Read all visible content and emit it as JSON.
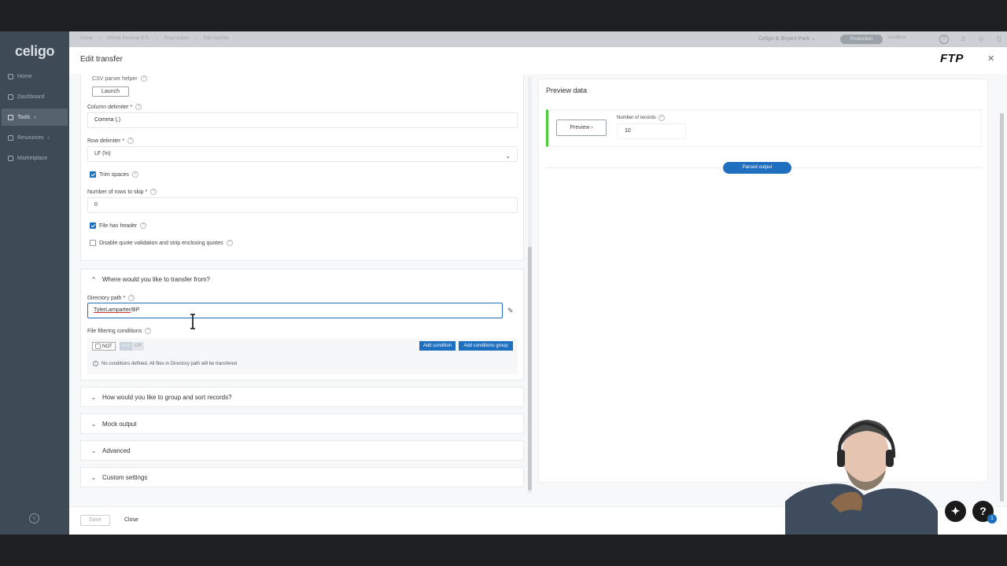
{
  "app": {
    "logo": "celigo"
  },
  "sidebar": {
    "items": [
      {
        "label": "Home"
      },
      {
        "label": "Dashboard"
      },
      {
        "label": "Tools"
      },
      {
        "label": "Resources"
      },
      {
        "label": "Marketplace"
      }
    ],
    "active_index": 2
  },
  "topbar": {
    "breadcrumbs": [
      "Home",
      "HSAW Reverse ETL",
      "Flow builder",
      "Edit transfer"
    ],
    "account": "Celigo & Bryant Park",
    "env_production": "Production",
    "env_sandbox": "Sandbox"
  },
  "drawer": {
    "title": "Edit transfer",
    "logo_text": "FTP"
  },
  "parser": {
    "csv_helper_label": "CSV parser helper",
    "launch_label": "Launch",
    "column_delimiter_label": "Column delimiter *",
    "column_delimiter_value": "Comma (,)",
    "row_delimiter_label": "Row delimiter *",
    "row_delimiter_value": "LF (\\n)",
    "trim_spaces_label": "Trim spaces",
    "trim_spaces_checked": true,
    "rows_to_skip_label": "Number of rows to skip *",
    "rows_to_skip_value": "0",
    "file_has_header_label": "File has header",
    "file_has_header_checked": true,
    "disable_quote_label": "Disable quote validation and strip enclosing quotes",
    "disable_quote_checked": false
  },
  "transfer_from": {
    "heading": "Where would you like to transfer from?",
    "directory_label": "Directory path *",
    "directory_value_underlined": "TylerLamparter",
    "directory_value_rest": "/BP",
    "filter_label": "File filtering conditions",
    "not_label": "NOT",
    "and_label": "and",
    "or_label": "OR",
    "add_condition": "Add condition",
    "add_group": "Add conditions group",
    "note": "No conditions defined. All files in Directory path will be transfered"
  },
  "sections": [
    {
      "label": "How would you like to group and sort records?"
    },
    {
      "label": "Mock output"
    },
    {
      "label": "Advanced"
    },
    {
      "label": "Custom settings"
    }
  ],
  "preview": {
    "title": "Preview data",
    "preview_button": "Preview",
    "records_label": "Number of records",
    "records_value": "10",
    "parsed_output": "Parsed output"
  },
  "footer": {
    "save": "Save",
    "close": "Close"
  },
  "floating": {
    "help": "?",
    "badge": "1"
  }
}
